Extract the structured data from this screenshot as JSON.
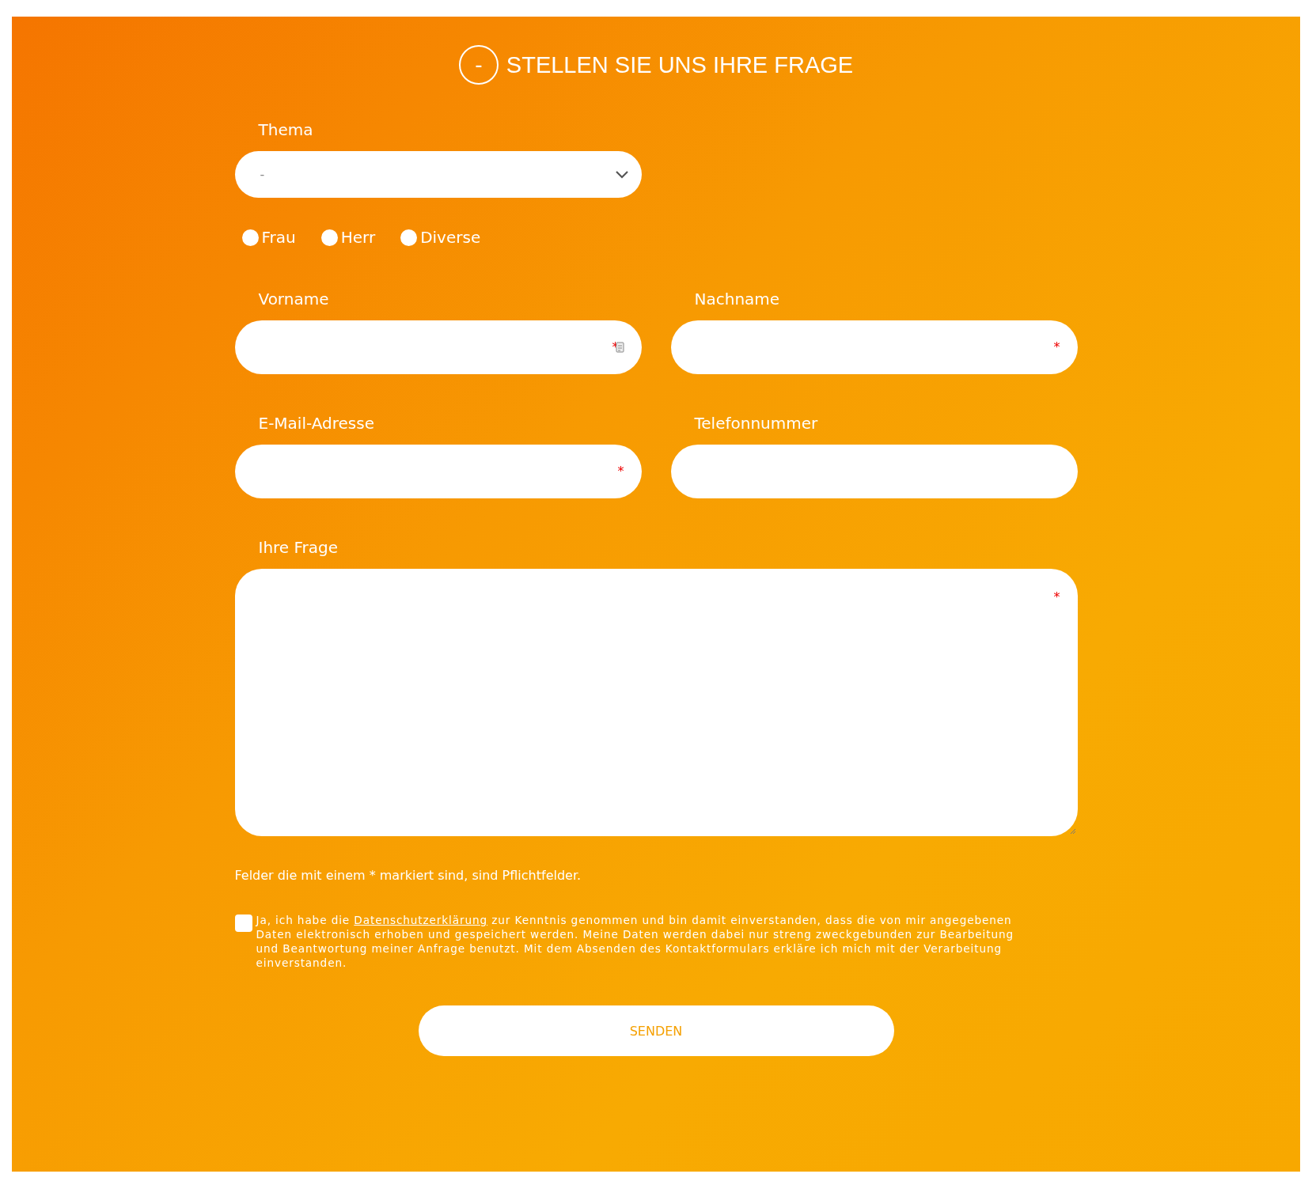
{
  "header": {
    "toggle": "-",
    "title": "STELLEN SIE UNS IHRE FRAGE"
  },
  "topic": {
    "label": "Thema",
    "value": "-"
  },
  "salutations": [
    {
      "label": "Frau",
      "selected": false
    },
    {
      "label": "Herr",
      "selected": false
    },
    {
      "label": "Diverse",
      "selected": false
    }
  ],
  "fields": [
    {
      "label": "Vorname",
      "required": true,
      "autofill": true
    },
    {
      "label": "Nachname",
      "required": true,
      "autofill": false
    },
    {
      "label": "E-Mail-Adresse",
      "required": true,
      "autofill": false
    },
    {
      "label": "Telefonnummer",
      "required": false,
      "autofill": false
    }
  ],
  "question": {
    "label": "Ihre Frage",
    "required": true
  },
  "required_mark": "*",
  "required_note": "Felder die mit einem * markiert sind, sind Pflichtfelder.",
  "consent": {
    "checked": false,
    "before": "Ja, ich habe die ",
    "link": "Datenschutzerklärung",
    "after": " zur Kenntnis genommen und bin damit einverstanden, dass die von mir angegebenen Daten elektronisch erhoben und gespeichert werden. Meine Daten werden dabei nur streng zweckgebunden zur Bearbeitung und Beantwortung meiner Anfrage benutzt. Mit dem Absenden des Kontaktformulars erkläre ich mich mit der Verarbeitung einverstanden."
  },
  "submit": "SENDEN"
}
